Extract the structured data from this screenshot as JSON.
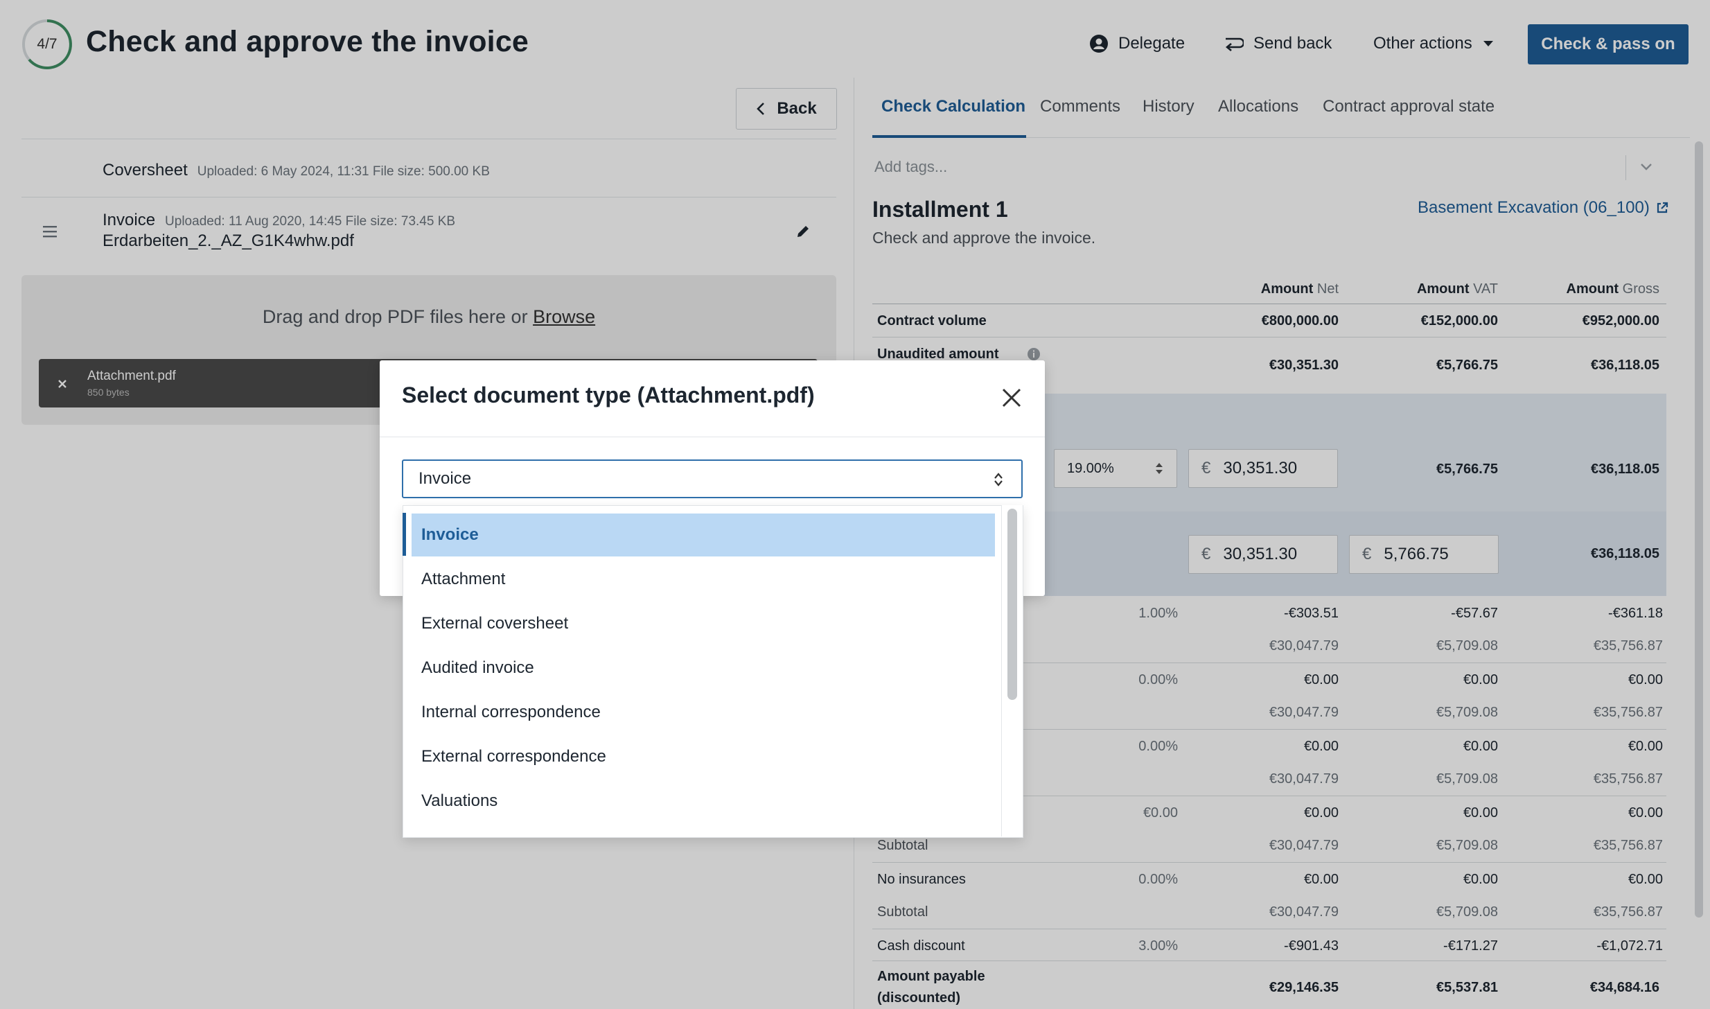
{
  "header": {
    "progress": "4/7",
    "progress_fraction": 0.5714,
    "title": "Check and approve the invoice",
    "delegate_label": "Delegate",
    "send_back_label": "Send back",
    "other_actions_label": "Other actions",
    "primary_label": "Check & pass on"
  },
  "left": {
    "back_label": "Back",
    "documents": [
      {
        "name": "Coversheet",
        "meta": "Uploaded: 6 May 2024, 11:31 File size: 500.00 KB",
        "file": ""
      },
      {
        "name": "Invoice",
        "meta": "Uploaded: 11 Aug 2020, 14:45 File size: 73.45 KB",
        "file": "Erdarbeiten_2._AZ_G1K4whw.pdf"
      }
    ],
    "dropzone_text": "Drag and drop PDF files here or",
    "browse_label": "Browse",
    "attachment": {
      "name": "Attachment.pdf",
      "size": "850 bytes"
    }
  },
  "right": {
    "tabs": [
      "Check Calculation",
      "Comments",
      "History",
      "Allocations",
      "Contract approval state"
    ],
    "tags_placeholder": "Add tags...",
    "installment_title": "Installment 1",
    "installment_sub": "Check and approve the invoice.",
    "contract_link": "Basement Excavation (06_100)",
    "columns": [
      {
        "label": "Amount",
        "sub": "Net"
      },
      {
        "label": "Amount",
        "sub": "VAT"
      },
      {
        "label": "Amount",
        "sub": "Gross"
      }
    ],
    "rows": {
      "contract_volume": {
        "label": "Contract volume",
        "net": "€800,000.00",
        "vat": "€152,000.00",
        "gross": "€952,000.00"
      },
      "unaudited": {
        "label": "Unaudited amount",
        "net": "€30,351.30",
        "vat": "€5,766.75",
        "gross": "€36,118.05"
      },
      "vat_row": {
        "rate": "19.00%",
        "input": "30,351.30",
        "vat": "€5,766.75",
        "gross": "€36,118.05"
      },
      "edit_row": {
        "net_input": "30,351.30",
        "vat_input": "5,766.75",
        "gross": "€36,118.05"
      },
      "deduction_rows": [
        {
          "pct": "1.00%",
          "net": "-€303.51",
          "vat": "-€57.67",
          "gross": "-€361.18",
          "sub_net": "€30,047.79",
          "sub_vat": "€5,709.08",
          "sub_gross": "€35,756.87"
        },
        {
          "pct": "0.00%",
          "net": "€0.00",
          "vat": "€0.00",
          "gross": "€0.00",
          "sub_net": "€30,047.79",
          "sub_vat": "€5,709.08",
          "sub_gross": "€35,756.87"
        },
        {
          "pct": "0.00%",
          "net": "€0.00",
          "vat": "€0.00",
          "gross": "€0.00",
          "sub_net": "€30,047.79",
          "sub_vat": "€5,709.08",
          "sub_gross": "€35,756.87"
        },
        {
          "pct": "€0.00",
          "net": "€0.00",
          "vat": "€0.00",
          "gross": "€0.00",
          "sub_label": "Subtotal",
          "sub_net": "€30,047.79",
          "sub_vat": "€5,709.08",
          "sub_gross": "€35,756.87"
        }
      ],
      "no_insurances": {
        "label": "No insurances",
        "pct": "0.00%",
        "net": "€0.00",
        "vat": "€0.00",
        "gross": "€0.00",
        "sub_label": "Subtotal",
        "sub_net": "€30,047.79",
        "sub_vat": "€5,709.08",
        "sub_gross": "€35,756.87"
      },
      "cash_discount": {
        "label": "Cash discount",
        "pct": "3.00%",
        "net": "-€901.43",
        "vat": "-€171.27",
        "gross": "-€1,072.71"
      },
      "payable": {
        "label_line1": "Amount payable",
        "label_line2": "(discounted)",
        "net": "€29,146.35",
        "vat": "€5,537.81",
        "gross": "€34,684.16"
      }
    }
  },
  "modal": {
    "title": "Select document type (Attachment.pdf)",
    "selected": "Invoice",
    "options": [
      "Invoice",
      "Attachment",
      "External coversheet",
      "Audited invoice",
      "Internal correspondence",
      "External correspondence",
      "Valuations"
    ]
  },
  "colors": {
    "primary": "#1e5d97",
    "selected_option_bg": "#bad8f4",
    "band": "#e4ebf3"
  }
}
